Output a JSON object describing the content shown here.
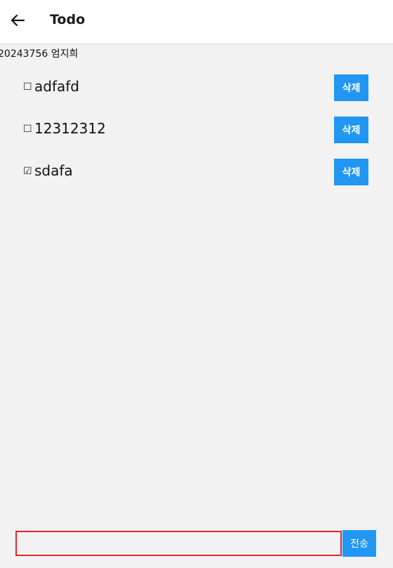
{
  "header": {
    "title": "Todo",
    "back_icon": "arrow-left-icon"
  },
  "student_label": "20243756 엄지희",
  "todos": [
    {
      "check": "☐",
      "checked": false,
      "text": "adfafd",
      "delete_label": "삭제"
    },
    {
      "check": "☐",
      "checked": false,
      "text": "12312312",
      "delete_label": "삭제"
    },
    {
      "check": "☑",
      "checked": true,
      "text": "sdafa",
      "delete_label": "삭제"
    }
  ],
  "composer": {
    "input_value": "",
    "input_placeholder": "",
    "send_label": "전송"
  },
  "colors": {
    "accent": "#2196f3",
    "input_border": "#e3242b",
    "background": "#f2f2f2"
  }
}
